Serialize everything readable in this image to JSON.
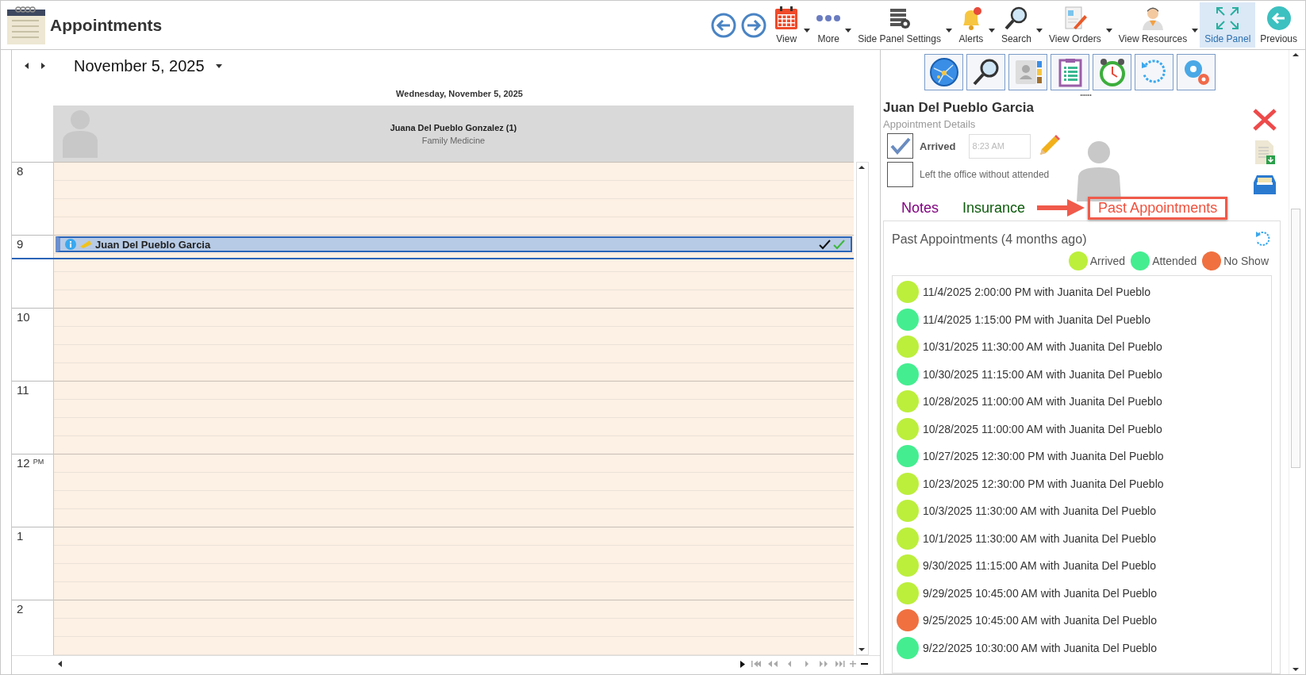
{
  "app": {
    "title": "Appointments"
  },
  "toolbar": {
    "buttons": [
      {
        "label": "View",
        "dropdown": true,
        "selected": false
      },
      {
        "label": "More",
        "dropdown": true,
        "selected": false
      },
      {
        "label": "Side Panel Settings",
        "dropdown": true,
        "selected": false
      },
      {
        "label": "Alerts",
        "dropdown": true,
        "selected": false
      },
      {
        "label": "Search",
        "dropdown": true,
        "selected": false
      },
      {
        "label": "View Orders",
        "dropdown": true,
        "selected": false
      },
      {
        "label": "View Resources",
        "dropdown": true,
        "selected": false
      },
      {
        "label": "Side Panel",
        "dropdown": false,
        "selected": true
      },
      {
        "label": "Previous",
        "dropdown": false,
        "selected": false
      }
    ]
  },
  "calendar": {
    "date": "November 5, 2025",
    "day_heading": "Wednesday, November 5, 2025",
    "resource": {
      "name": "Juana Del Pueblo Gonzalez (1)",
      "specialty": "Family Medicine"
    },
    "hours": [
      {
        "label": "8"
      },
      {
        "label": "9",
        "appointment": {
          "name": "Juan Del Pueblo Garcia",
          "selected": true
        }
      },
      {
        "label": "10"
      },
      {
        "label": "11"
      },
      {
        "label": "12",
        "suffix": "PM"
      },
      {
        "label": "1"
      },
      {
        "label": "2"
      }
    ]
  },
  "side_panel": {
    "patient": {
      "name": "Juan Del Pueblo Garcia",
      "subtitle": "Appointment Details"
    },
    "arrived": {
      "label": "Arrived",
      "checked": true,
      "time": "8:23 AM"
    },
    "left_office": {
      "label": "Left the office without attended",
      "checked": false
    },
    "tabs": [
      {
        "label": "Notes",
        "selected": false,
        "color": "#800080"
      },
      {
        "label": "Insurance",
        "selected": false,
        "color": "#0b5a0b"
      },
      {
        "label": "Past Appointments",
        "selected": true,
        "color": "#f0503c"
      }
    ],
    "past_appointments": {
      "title": "Past Appointments (4 months ago)",
      "legend": [
        {
          "label": "Arrived",
          "color": "#bcef3c"
        },
        {
          "label": "Attended",
          "color": "#44ee90"
        },
        {
          "label": "No Show",
          "color": "#f07040"
        }
      ],
      "rows": [
        {
          "text": "11/4/2025 2:00:00 PM with Juanita Del Pueblo",
          "color": "#bcef3c"
        },
        {
          "text": "11/4/2025 1:15:00 PM with Juanita Del Pueblo",
          "color": "#44ee90"
        },
        {
          "text": "10/31/2025 11:30:00 AM with Juanita Del Pueblo",
          "color": "#bcef3c"
        },
        {
          "text": "10/30/2025 11:15:00 AM with Juanita Del Pueblo",
          "color": "#44ee90"
        },
        {
          "text": "10/28/2025 11:00:00 AM with Juanita Del Pueblo",
          "color": "#bcef3c"
        },
        {
          "text": "10/28/2025 11:00:00 AM with Juanita Del Pueblo",
          "color": "#bcef3c"
        },
        {
          "text": "10/27/2025 12:30:00 PM with Juanita Del Pueblo",
          "color": "#44ee90"
        },
        {
          "text": "10/23/2025 12:30:00 PM with Juanita Del Pueblo",
          "color": "#bcef3c"
        },
        {
          "text": "10/3/2025 11:30:00 AM with Juanita Del Pueblo",
          "color": "#bcef3c"
        },
        {
          "text": "10/1/2025 11:30:00 AM with Juanita Del Pueblo",
          "color": "#bcef3c"
        },
        {
          "text": "9/30/2025 11:15:00 AM with Juanita Del Pueblo",
          "color": "#bcef3c"
        },
        {
          "text": "9/29/2025 10:45:00 AM with Juanita Del Pueblo",
          "color": "#bcef3c"
        },
        {
          "text": "9/25/2025 10:45:00 AM with Juanita Del Pueblo",
          "color": "#f07040"
        },
        {
          "text": "9/22/2025 10:30:00 AM with Juanita Del Pueblo",
          "color": "#44ee90"
        }
      ]
    }
  }
}
